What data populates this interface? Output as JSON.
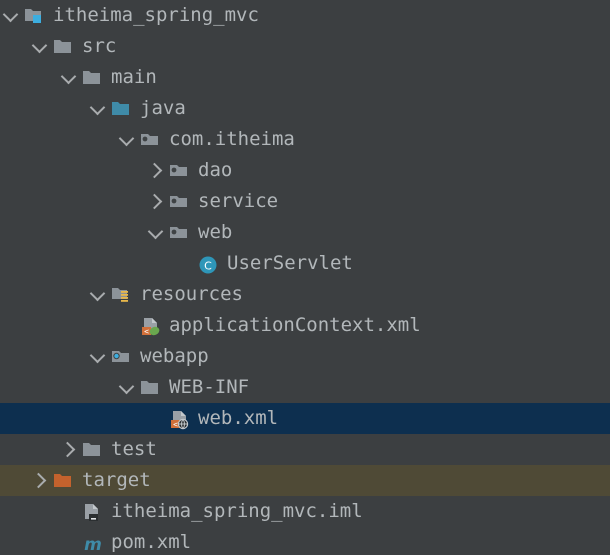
{
  "theme": {
    "background": "#3c3f41",
    "text": "#b2b7ba",
    "selection_background": "#0d2f4f",
    "excluded_row_background": "#4f4a36",
    "folder_gray": "#8c9399",
    "source_root_blue": "#3f8ba8",
    "excluded_orange": "#c4622d",
    "class_icon_teal": "#2e96b8",
    "maven_blue": "#3f8ba8",
    "spring_green": "#6aa84f",
    "xml_badge_orange": "#d2703a",
    "resource_stripe_yellow": "#e8b84b",
    "chevron": "#a9acae"
  },
  "tree": {
    "name": "project-tree",
    "rows": [
      {
        "label": "itheima_spring_mvc",
        "depth": 0,
        "expander": "expanded",
        "icon": "module-icon",
        "selected": false,
        "excluded": false
      },
      {
        "label": "src",
        "depth": 1,
        "expander": "expanded",
        "icon": "folder-icon",
        "selected": false,
        "excluded": false
      },
      {
        "label": "main",
        "depth": 2,
        "expander": "expanded",
        "icon": "folder-icon",
        "selected": false,
        "excluded": false
      },
      {
        "label": "java",
        "depth": 3,
        "expander": "expanded",
        "icon": "source-root-folder-icon",
        "selected": false,
        "excluded": false
      },
      {
        "label": "com.itheima",
        "depth": 4,
        "expander": "expanded",
        "icon": "package-icon",
        "selected": false,
        "excluded": false
      },
      {
        "label": "dao",
        "depth": 5,
        "expander": "collapsed",
        "icon": "package-icon",
        "selected": false,
        "excluded": false
      },
      {
        "label": "service",
        "depth": 5,
        "expander": "collapsed",
        "icon": "package-icon",
        "selected": false,
        "excluded": false
      },
      {
        "label": "web",
        "depth": 5,
        "expander": "expanded",
        "icon": "package-icon",
        "selected": false,
        "excluded": false
      },
      {
        "label": "UserServlet",
        "depth": 6,
        "expander": "none",
        "icon": "java-class-icon",
        "selected": false,
        "excluded": false
      },
      {
        "label": "resources",
        "depth": 3,
        "expander": "expanded",
        "icon": "resources-folder-icon",
        "selected": false,
        "excluded": false
      },
      {
        "label": "applicationContext.xml",
        "depth": 4,
        "expander": "none",
        "icon": "spring-xml-file-icon",
        "selected": false,
        "excluded": false
      },
      {
        "label": "webapp",
        "depth": 3,
        "expander": "expanded",
        "icon": "web-root-folder-icon",
        "selected": false,
        "excluded": false
      },
      {
        "label": "WEB-INF",
        "depth": 4,
        "expander": "expanded",
        "icon": "folder-icon",
        "selected": false,
        "excluded": false
      },
      {
        "label": "web.xml",
        "depth": 5,
        "expander": "none",
        "icon": "web-xml-file-icon",
        "selected": true,
        "excluded": false
      },
      {
        "label": "test",
        "depth": 2,
        "expander": "collapsed",
        "icon": "folder-icon",
        "selected": false,
        "excluded": false
      },
      {
        "label": "target",
        "depth": 1,
        "expander": "collapsed",
        "icon": "excluded-folder-icon",
        "selected": false,
        "excluded": true
      },
      {
        "label": "itheima_spring_mvc.iml",
        "depth": 2,
        "expander": "none",
        "icon": "iml-file-icon",
        "selected": false,
        "excluded": false
      },
      {
        "label": "pom.xml",
        "depth": 2,
        "expander": "none",
        "icon": "maven-pom-icon",
        "selected": false,
        "excluded": false
      }
    ]
  }
}
